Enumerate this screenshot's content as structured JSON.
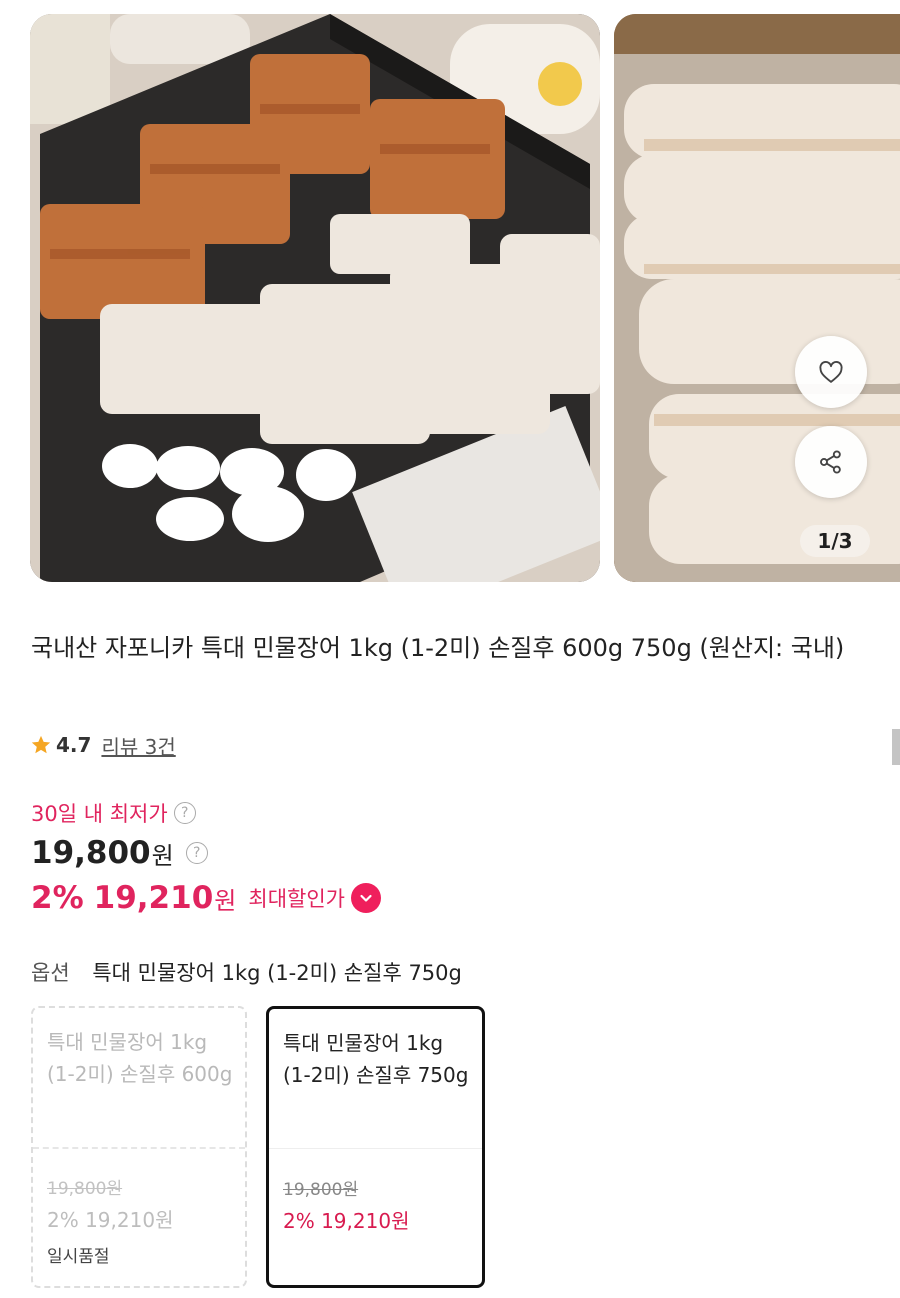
{
  "gallery": {
    "image_counter": "1/3",
    "icons": {
      "like": "heart-icon",
      "share": "share-icon"
    }
  },
  "product": {
    "title": "국내산 자포니카 특대 민물장어 1kg (1-2미) 손질후 600g 750g (원산지: 국내)",
    "rating": "4.7",
    "reviews": "리뷰 3건",
    "lowest_label": "30일 내 최저가",
    "original_price": "19,800",
    "price_unit": "원",
    "discount_percent": "2%",
    "sale_price": "19,210",
    "max_discount_label": "최대할인가"
  },
  "option": {
    "label": "옵션",
    "selected": "특대 민물장어 1kg (1-2미) 손질후 750g",
    "cards": [
      {
        "name": "특대 민물장어 1kg (1-2미) 손질후 600g",
        "original_price": "19,800원",
        "sale_price": "2% 19,210원",
        "status": "일시품절"
      },
      {
        "name": "특대 민물장어 1kg (1-2미) 손질후 750g",
        "original_price": "19,800원",
        "sale_price": "2% 19,210원"
      }
    ]
  },
  "colors": {
    "accent": "#e0245e",
    "badge": "#ef1f5c",
    "star": "#f5a623"
  }
}
